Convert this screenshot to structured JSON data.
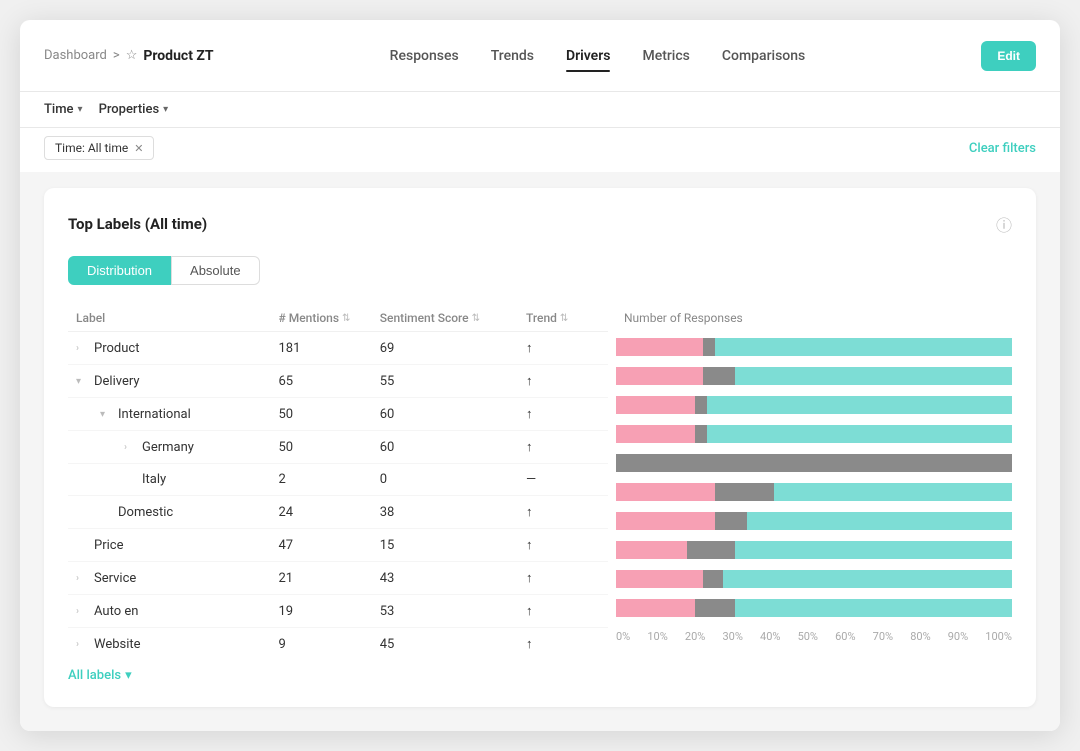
{
  "breadcrumb": {
    "dashboard": "Dashboard",
    "separator": ">",
    "star": "☆",
    "product": "Product ZT"
  },
  "nav": {
    "tabs": [
      {
        "label": "Responses",
        "active": false
      },
      {
        "label": "Trends",
        "active": false
      },
      {
        "label": "Drivers",
        "active": true
      },
      {
        "label": "Metrics",
        "active": false
      },
      {
        "label": "Comparisons",
        "active": false
      }
    ],
    "edit_btn": "Edit"
  },
  "filters": {
    "time_label": "Time",
    "properties_label": "Properties",
    "active_filter": "Time: All time",
    "clear": "Clear filters"
  },
  "card": {
    "title": "Top Labels (All time)",
    "help": "?",
    "toggle": {
      "distribution": "Distribution",
      "absolute": "Absolute"
    }
  },
  "table": {
    "col_label": "Label",
    "col_mentions": "# Mentions",
    "col_sentiment": "Sentiment Score",
    "col_trend": "Trend",
    "col_responses": "Number of Responses",
    "rows": [
      {
        "indent": 0,
        "expandable": true,
        "expanded": false,
        "label": "Product",
        "mentions": "181",
        "sentiment": "69",
        "trend": "↑",
        "pink": 22,
        "gray": 3,
        "teal": 75
      },
      {
        "indent": 0,
        "expandable": true,
        "expanded": true,
        "label": "Delivery",
        "mentions": "65",
        "sentiment": "55",
        "trend": "↑",
        "pink": 22,
        "gray": 8,
        "teal": 70
      },
      {
        "indent": 1,
        "expandable": true,
        "expanded": true,
        "label": "International",
        "mentions": "50",
        "sentiment": "60",
        "trend": "↑",
        "pink": 20,
        "gray": 3,
        "teal": 77
      },
      {
        "indent": 2,
        "expandable": true,
        "expanded": false,
        "label": "Germany",
        "mentions": "50",
        "sentiment": "60",
        "trend": "↑",
        "pink": 20,
        "gray": 3,
        "teal": 77
      },
      {
        "indent": 2,
        "expandable": false,
        "expanded": false,
        "label": "Italy",
        "mentions": "2",
        "sentiment": "0",
        "trend": "—",
        "pink": 0,
        "gray": 100,
        "teal": 0
      },
      {
        "indent": 1,
        "expandable": false,
        "expanded": false,
        "label": "Domestic",
        "mentions": "24",
        "sentiment": "38",
        "trend": "↑",
        "pink": 25,
        "gray": 15,
        "teal": 60
      },
      {
        "indent": 0,
        "expandable": false,
        "expanded": false,
        "label": "Price",
        "mentions": "47",
        "sentiment": "15",
        "trend": "↑",
        "pink": 25,
        "gray": 8,
        "teal": 67
      },
      {
        "indent": 0,
        "expandable": true,
        "expanded": false,
        "label": "Service",
        "mentions": "21",
        "sentiment": "43",
        "trend": "↑",
        "pink": 18,
        "gray": 12,
        "teal": 70
      },
      {
        "indent": 0,
        "expandable": true,
        "expanded": false,
        "label": "Auto en",
        "mentions": "19",
        "sentiment": "53",
        "trend": "↑",
        "pink": 22,
        "gray": 5,
        "teal": 73
      },
      {
        "indent": 0,
        "expandable": true,
        "expanded": false,
        "label": "Website",
        "mentions": "9",
        "sentiment": "45",
        "trend": "↑",
        "pink": 20,
        "gray": 10,
        "teal": 70
      }
    ],
    "x_axis": [
      "0%",
      "10%",
      "20%",
      "30%",
      "40%",
      "50%",
      "60%",
      "70%",
      "80%",
      "90%",
      "100%"
    ],
    "all_labels": "All labels"
  }
}
